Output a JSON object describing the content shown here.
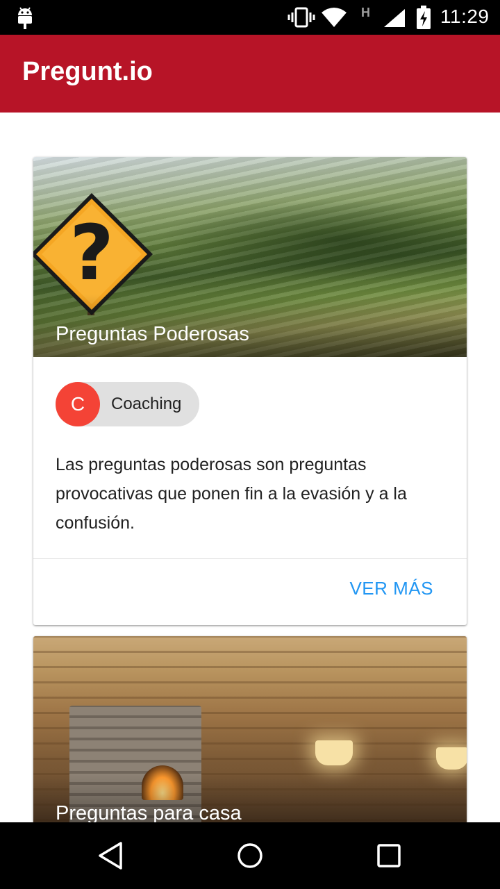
{
  "status_bar": {
    "time": "11:29",
    "network_type": "H",
    "icons": [
      "android-icon",
      "vibrate-icon",
      "wifi-icon",
      "signal-icon",
      "battery-charging-icon"
    ]
  },
  "app_bar": {
    "title": "Pregunt.io",
    "color": "#b71427"
  },
  "cards": [
    {
      "title": "Preguntas Poderosas",
      "image": "question-mark-road-sign-motion-blur",
      "chip": {
        "initial": "C",
        "label": "Coaching",
        "avatar_color": "#f44336"
      },
      "description": "Las preguntas poderosas son preguntas provocativas que ponen fin a la evasión y a la confusión.",
      "action_label": "VER MÁS"
    },
    {
      "title": "Preguntas para casa",
      "image": "log-cabin-living-room"
    }
  ],
  "nav_bar": {
    "buttons": [
      "back-icon",
      "home-icon",
      "recents-icon"
    ]
  },
  "colors": {
    "accent": "#2196f3",
    "primary": "#b71427",
    "chip_avatar": "#f44336"
  }
}
